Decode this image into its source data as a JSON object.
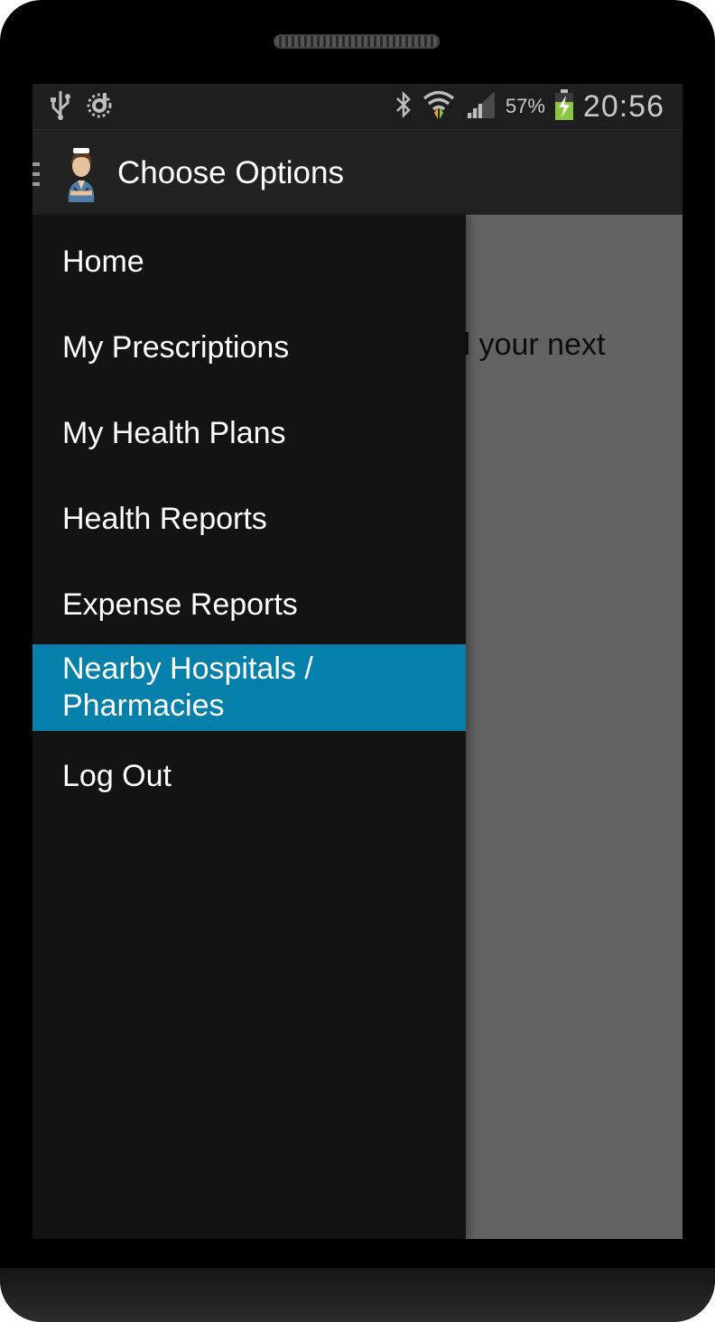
{
  "status_bar": {
    "battery_percent": "57%",
    "time": "20:56",
    "icons": [
      "usb-icon",
      "sync-icon",
      "bluetooth-icon",
      "wifi-icon",
      "signal-icon",
      "battery-charging-icon"
    ]
  },
  "action_bar": {
    "title": "Choose Options",
    "icons": [
      "drawer-indicator-icon",
      "nurse-avatar-icon"
    ]
  },
  "background": {
    "partial_text": "il your next"
  },
  "drawer": {
    "selected_index": 5,
    "items": [
      {
        "label": "Home"
      },
      {
        "label": "My Prescriptions"
      },
      {
        "label": "My Health Plans"
      },
      {
        "label": "Health Reports"
      },
      {
        "label": "Expense Reports"
      },
      {
        "label": "Nearby Hospitals / Pharmacies"
      },
      {
        "label": "Log Out"
      }
    ]
  },
  "colors": {
    "selected_item": "#0580aa",
    "drawer_background": "#131313",
    "action_bar": "#222222",
    "content_dimmed": "#636363"
  }
}
